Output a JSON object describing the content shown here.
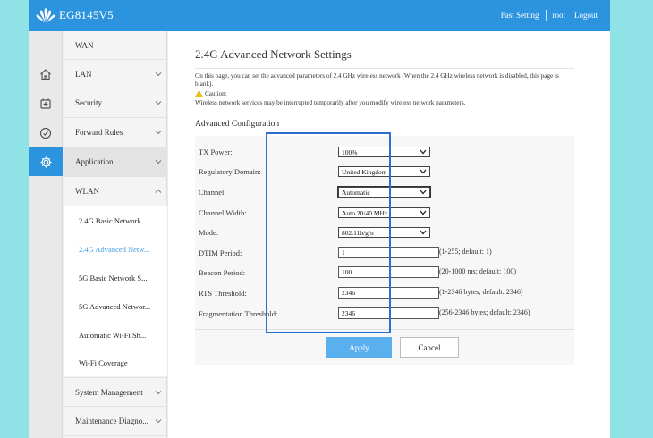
{
  "header": {
    "brand": "EG8145V5",
    "links": [
      "Fast Setting",
      "root",
      "Logout"
    ]
  },
  "iconbar": {
    "items": [
      {
        "icon": "home-icon"
      },
      {
        "icon": "plus-box-icon"
      },
      {
        "icon": "gauge-icon"
      },
      {
        "icon": "gear-icon",
        "active": true
      }
    ]
  },
  "menu": {
    "items": [
      {
        "label": "WAN",
        "chevron": ""
      },
      {
        "label": "LAN",
        "chevron": "down"
      },
      {
        "label": "Security",
        "chevron": "down"
      },
      {
        "label": "Forward Rules",
        "chevron": "down"
      },
      {
        "label": "Application",
        "chevron": "down"
      },
      {
        "label": "WLAN",
        "chevron": "up"
      }
    ],
    "wlan_sub": [
      "2.4G Basic Network...",
      "2.4G Advanced Netw...",
      "5G Basic Network S...",
      "5G Advanced Networ...",
      "Automatic Wi-Fi Sh...",
      "Wi-Fi Coverage"
    ],
    "bottom_items": [
      {
        "label": "System Management",
        "chevron": "down"
      },
      {
        "label": "Maintenance Diagno...",
        "chevron": "down"
      }
    ]
  },
  "page": {
    "title": "2.4G Advanced Network Settings",
    "description": "On this page, you can set the advanced parameters of 2.4 GHz wireless network (When the 2.4 GHz wireless network is disabled, this page is blank).",
    "caution_label": "Caution:",
    "caution_text": "Wireless network services may be interrupted temporarily after you modify wireless network parameters.",
    "section_title": "Advanced Configuration"
  },
  "form": {
    "tx_power": {
      "label": "TX Power:",
      "value": "100%"
    },
    "regulatory_domain": {
      "label": "Regulatory Domain:",
      "value": "United Kingdom"
    },
    "channel": {
      "label": "Channel:",
      "value": "Automatic"
    },
    "channel_width": {
      "label": "Channel Width:",
      "value": "Auto 20/40 MHz"
    },
    "mode": {
      "label": "Mode:",
      "value": "802.11b/g/n"
    },
    "dtim": {
      "label": "DTIM Period:",
      "value": "1",
      "hint": "(1-255; default: 1)"
    },
    "beacon": {
      "label": "Beacon Period:",
      "value": "100",
      "hint": "(20-1000 ms; default: 100)"
    },
    "rts": {
      "label": "RTS Threshold:",
      "value": "2346",
      "hint": "(1-2346 bytes; default: 2346)"
    },
    "frag": {
      "label": "Fragmentation Threshold:",
      "value": "2346",
      "hint": "(256-2346 bytes; default: 2346)"
    }
  },
  "buttons": {
    "apply": "Apply",
    "cancel": "Cancel"
  },
  "colors": {
    "header_bg": "#2c93de",
    "apply_bg": "#5ab0ef",
    "highlight_border": "#2d6fd1",
    "page_bg": "#8fe3e6"
  }
}
